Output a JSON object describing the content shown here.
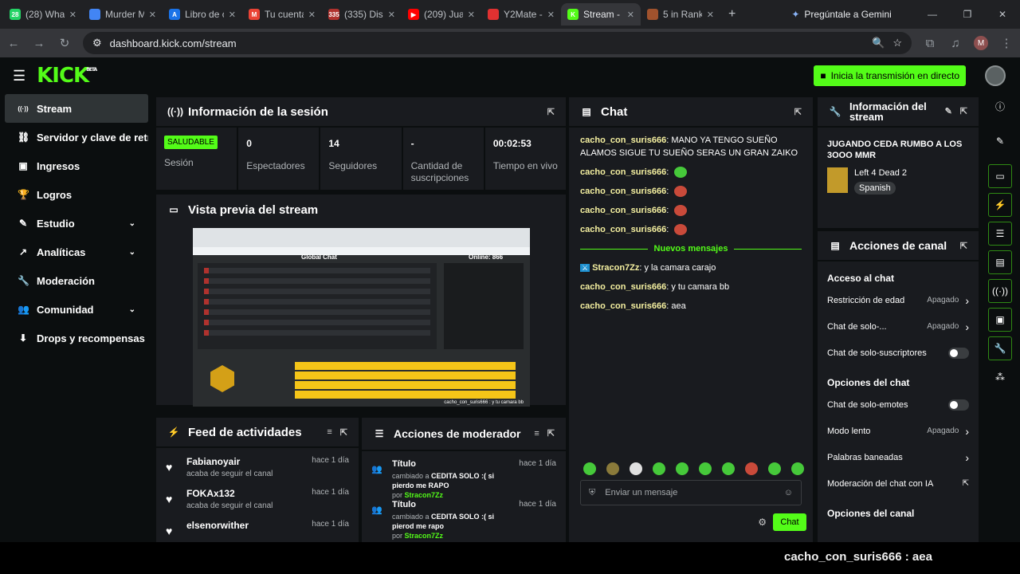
{
  "browser": {
    "tabs": [
      {
        "title": "(28) Wha",
        "color": "#25d366",
        "glyph": "28"
      },
      {
        "title": "Murder M",
        "color": "#4285f4",
        "glyph": ""
      },
      {
        "title": "Libro de c",
        "color": "#1a73e8",
        "glyph": "A"
      },
      {
        "title": "Tu cuenta",
        "color": "#ea4335",
        "glyph": "M"
      },
      {
        "title": "(335) Dis",
        "color": "#b0322e",
        "glyph": "335"
      },
      {
        "title": "(209) Jua",
        "color": "#ff0000",
        "glyph": "▶"
      },
      {
        "title": "Y2Mate -",
        "color": "#e03131",
        "glyph": ""
      },
      {
        "title": "Stream -",
        "color": "#53fc18",
        "glyph": "K"
      },
      {
        "title": "5 in Rank",
        "color": "#a0522d",
        "glyph": ""
      }
    ],
    "active_tab_index": 7,
    "gemini_label": "Pregúntale a Gemini",
    "url": "dashboard.kick.com/stream",
    "profile_initial": "M"
  },
  "app": {
    "logo": "KICK",
    "logo_beta": "BETA",
    "go_live": "Inicia la transmisión en directo",
    "sidebar": [
      {
        "label": "Stream",
        "icon": "broadcast-icon",
        "glyph": "((·))",
        "active": true,
        "chevron": false
      },
      {
        "label": "Servidor y clave de retransmisión",
        "icon": "link-icon",
        "glyph": "⛓",
        "active": false,
        "chevron": false
      },
      {
        "label": "Ingresos",
        "icon": "revenue-icon",
        "glyph": "▣",
        "active": false,
        "chevron": false
      },
      {
        "label": "Logros",
        "icon": "trophy-icon",
        "glyph": "🏆",
        "active": false,
        "chevron": false
      },
      {
        "label": "Estudio",
        "icon": "studio-icon",
        "glyph": "✎",
        "active": false,
        "chevron": true
      },
      {
        "label": "Analíticas",
        "icon": "analytics-icon",
        "glyph": "↗",
        "active": false,
        "chevron": true
      },
      {
        "label": "Moderación",
        "icon": "wrench-icon",
        "glyph": "🔧",
        "active": false,
        "chevron": false
      },
      {
        "label": "Comunidad",
        "icon": "community-icon",
        "glyph": "👥",
        "active": false,
        "chevron": true
      },
      {
        "label": "Drops y recompensas",
        "icon": "drops-icon",
        "glyph": "⬇",
        "active": false,
        "chevron": false
      }
    ]
  },
  "session": {
    "title": "Información de la sesión",
    "health_badge": "SALUDABLE",
    "stats": [
      {
        "value": "",
        "label": "Sesión"
      },
      {
        "value": "0",
        "label": "Espectadores"
      },
      {
        "value": "14",
        "label": "Seguidores"
      },
      {
        "value": "-",
        "label": "Cantidad de suscripciones"
      },
      {
        "value": "00:02:53",
        "label": "Tiempo en vivo"
      }
    ]
  },
  "preview": {
    "title": "Vista previa del stream",
    "inner_chat_title": "Global Chat",
    "inner_online": "Online: 866",
    "inner_caption": "cacho_con_suris666 : y tu camara bb"
  },
  "feed": {
    "title": "Feed de actividades",
    "items": [
      {
        "name": "Fabianoyair",
        "action": "acaba de seguir el canal",
        "time": "hace 1 día"
      },
      {
        "name": "FOKAx132",
        "action": "acaba de seguir el canal",
        "time": "hace 1 día"
      },
      {
        "name": "elsenorwither",
        "action": "",
        "time": "hace 1 día"
      }
    ]
  },
  "modactions": {
    "title": "Acciones de moderador",
    "items": [
      {
        "label": "Título",
        "changed": "cambiado a",
        "value": "CEDITA SOLO :( si pierdo me RAPO",
        "by": "por",
        "user": "Stracon7Zz",
        "time": "hace 1 día"
      },
      {
        "label": "Título",
        "changed": "cambiado a",
        "value": "CEDITA SOLO :( si pierod me rapo",
        "by": "por",
        "user": "Stracon7Zz",
        "time": "hace 1 día"
      }
    ]
  },
  "chat": {
    "title": "Chat",
    "messages_before": [
      {
        "user": "cacho_con_suris666",
        "text": "MANO YA TENGO SUEÑO ALAMOS SIGUE TU SUEÑO SERAS UN GRAN ZAIKO",
        "emote": ""
      },
      {
        "user": "cacho_con_suris666",
        "text": "",
        "emote": "#46c93a"
      },
      {
        "user": "cacho_con_suris666",
        "text": "",
        "emote": "#c94a3a"
      },
      {
        "user": "cacho_con_suris666",
        "text": "",
        "emote": "#c94a3a"
      },
      {
        "user": "cacho_con_suris666",
        "text": "",
        "emote": "#c94a3a"
      }
    ],
    "new_messages_label": "Nuevos mensajes",
    "messages_after": [
      {
        "user": "Stracon7Zz",
        "text": "y la camara carajo"
      },
      {
        "user": "cacho_con_suris666",
        "text": "y tu camara bb"
      },
      {
        "user": "cacho_con_suris666",
        "text": "aea"
      }
    ],
    "emote_colors": [
      "#46c93a",
      "#8a7a3a",
      "#e0e0e0",
      "#46c93a",
      "#46c93a",
      "#46c93a",
      "#46c93a",
      "#c94a3a",
      "#46c93a",
      "#46c93a"
    ],
    "input_placeholder": "Enviar un mensaje",
    "send_label": "Chat"
  },
  "stream_info": {
    "title": "Información del stream",
    "stream_title": "JUGANDO CEDA RUMBO A LOS 3OOO MMR",
    "game": "Left 4 Dead 2",
    "language": "Spanish"
  },
  "channel_actions": {
    "title": "Acciones de canal",
    "chat_access": "Acceso al chat",
    "rows1": [
      {
        "label": "Restricción de edad",
        "value": "Apagado",
        "type": "arrow"
      },
      {
        "label": "Chat de solo-...",
        "value": "Apagado",
        "type": "arrow"
      },
      {
        "label": "Chat de solo-suscriptores",
        "value": "",
        "type": "toggle"
      }
    ],
    "chat_options": "Opciones del chat",
    "rows2": [
      {
        "label": "Chat de solo-emotes",
        "value": "",
        "type": "toggle"
      },
      {
        "label": "Modo lento",
        "value": "Apagado",
        "type": "arrow"
      },
      {
        "label": "Palabras baneadas",
        "value": "",
        "type": "arrow"
      },
      {
        "label": "Moderación del chat con IA",
        "value": "",
        "type": "external"
      }
    ],
    "channel_options": "Opciones del canal"
  },
  "caption": "cacho_con_suris666 : aea",
  "colors": {
    "accent": "#53fc18",
    "bg": "#0b0e0f",
    "panel": "#191b1f"
  }
}
